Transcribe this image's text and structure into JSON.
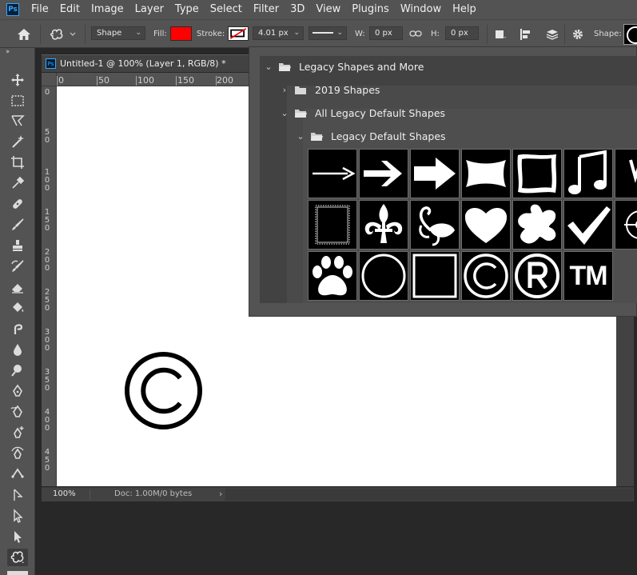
{
  "menubar": {
    "logo": "Ps",
    "items": [
      "File",
      "Edit",
      "Image",
      "Layer",
      "Type",
      "Select",
      "Filter",
      "3D",
      "View",
      "Plugins",
      "Window",
      "Help"
    ]
  },
  "options": {
    "mode": "Shape",
    "fill_label": "Fill:",
    "fill_color": "#ff0000",
    "stroke_label": "Stroke:",
    "stroke_width": "4.01 px",
    "w_label": "W:",
    "w_value": "0 px",
    "h_label": "H:",
    "h_value": "0 px",
    "shape_label": "Shape:"
  },
  "document": {
    "tab_title": "Untitled-1 @ 100% (Layer 1, RGB/8) *",
    "ruler_top": [
      "0",
      "50",
      "100",
      "150",
      "200"
    ],
    "ruler_left": [
      "0",
      "5\n0",
      "1\n0\n0",
      "1\n5\n0",
      "2\n0\n0",
      "2\n5\n0",
      "3\n0\n0",
      "3\n5\n0",
      "4\n0\n0",
      "4\n5\n0"
    ],
    "zoom": "100%",
    "doc_info": "Doc: 1.00M/0 bytes"
  },
  "shape_panel": {
    "root_group": "Legacy Shapes and More",
    "group_2019": "2019 Shapes",
    "group_all_legacy": "All Legacy Default Shapes",
    "group_legacy_default": "Legacy Default Shapes",
    "shapes": [
      "arrow-thin",
      "arrow-medium",
      "arrow-bold",
      "banner",
      "frame-wavy",
      "music-note",
      "partial",
      "frame-stamp",
      "fleur-de-lis",
      "ornament-leaf",
      "heart",
      "splat",
      "checkmark",
      "target-partial",
      "paw-print",
      "circle-frame",
      "square-frame",
      "copyright",
      "registered",
      "trademark"
    ],
    "trademark_text": "TM"
  },
  "colors": {
    "menubar_bg": "#535353",
    "workspace_bg": "#282828",
    "accent": "#31a8ff",
    "fill_swatch": "#ff0000"
  }
}
